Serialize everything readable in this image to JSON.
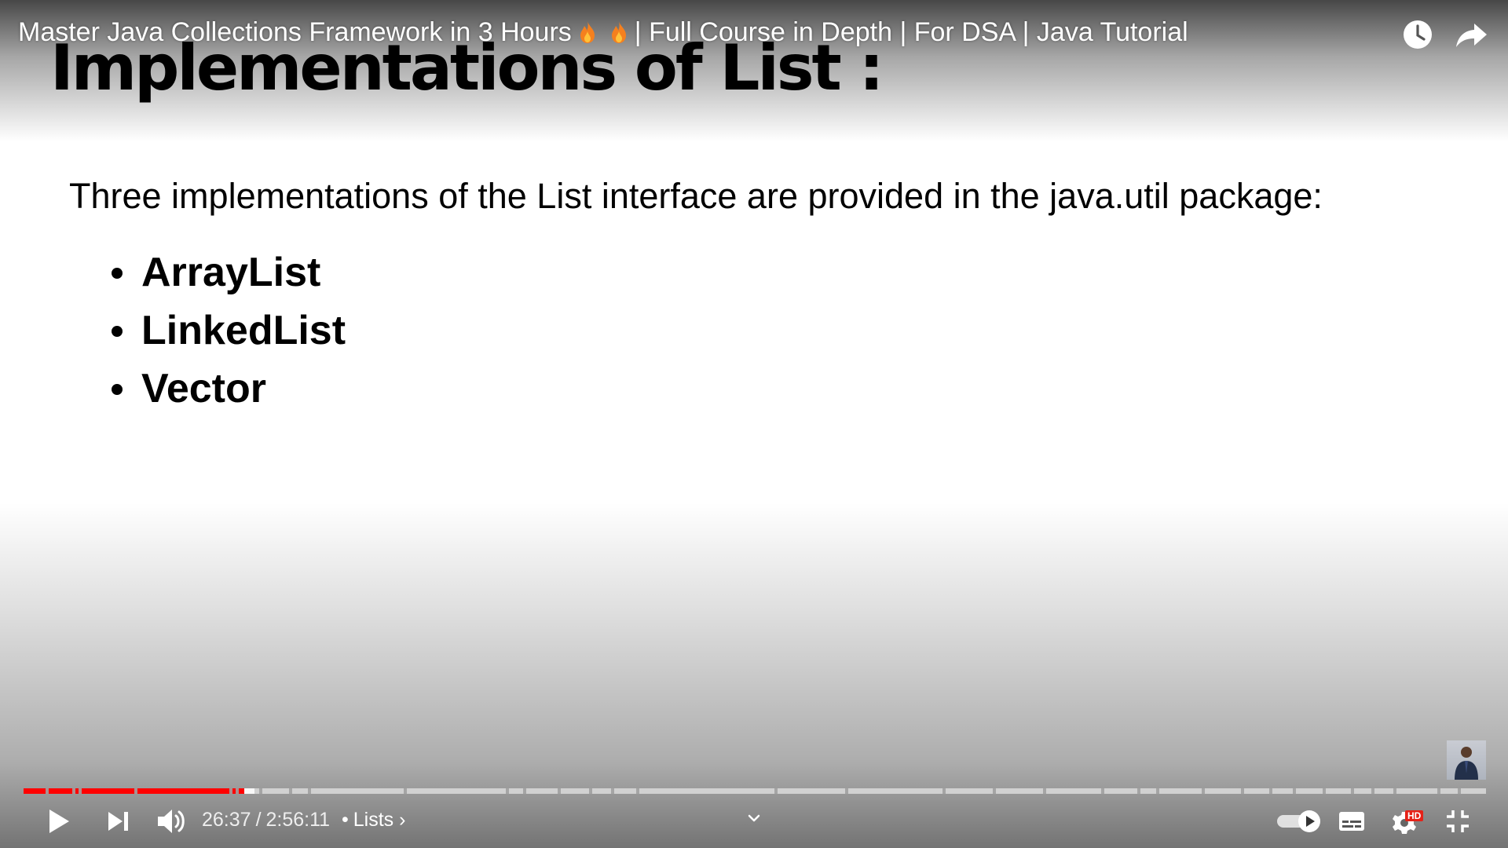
{
  "video": {
    "title_part1": "Master Java Collections Framework in 3 Hours",
    "title_part2": "| Full Course in Depth | For DSA | Java Tutorial",
    "title_icons": [
      "fire-icon",
      "fire-icon"
    ]
  },
  "slide": {
    "heading": "Implementations of List  :",
    "intro": "Three implementations of the List interface are provided in the java.util package:",
    "items": [
      "ArrayList",
      "LinkedList",
      "Vector"
    ]
  },
  "player": {
    "current_time": "26:37",
    "separator": "/",
    "duration": "2:56:11",
    "chapter_dot": "•",
    "chapter": "Lists",
    "chapter_chevron": "›",
    "progress_played_fraction": 0.151,
    "progress_loaded_fraction": 0.158,
    "hd_badge": "HD",
    "icons": [
      "play-icon",
      "next-icon",
      "volume-icon",
      "chevron-down-icon",
      "autoplay-toggle-icon",
      "subtitles-icon",
      "settings-icon",
      "fullscreen-exit-icon",
      "clock-icon",
      "share-icon"
    ],
    "colors": {
      "played": "#ff0000",
      "hd_badge": "#e62117"
    }
  }
}
